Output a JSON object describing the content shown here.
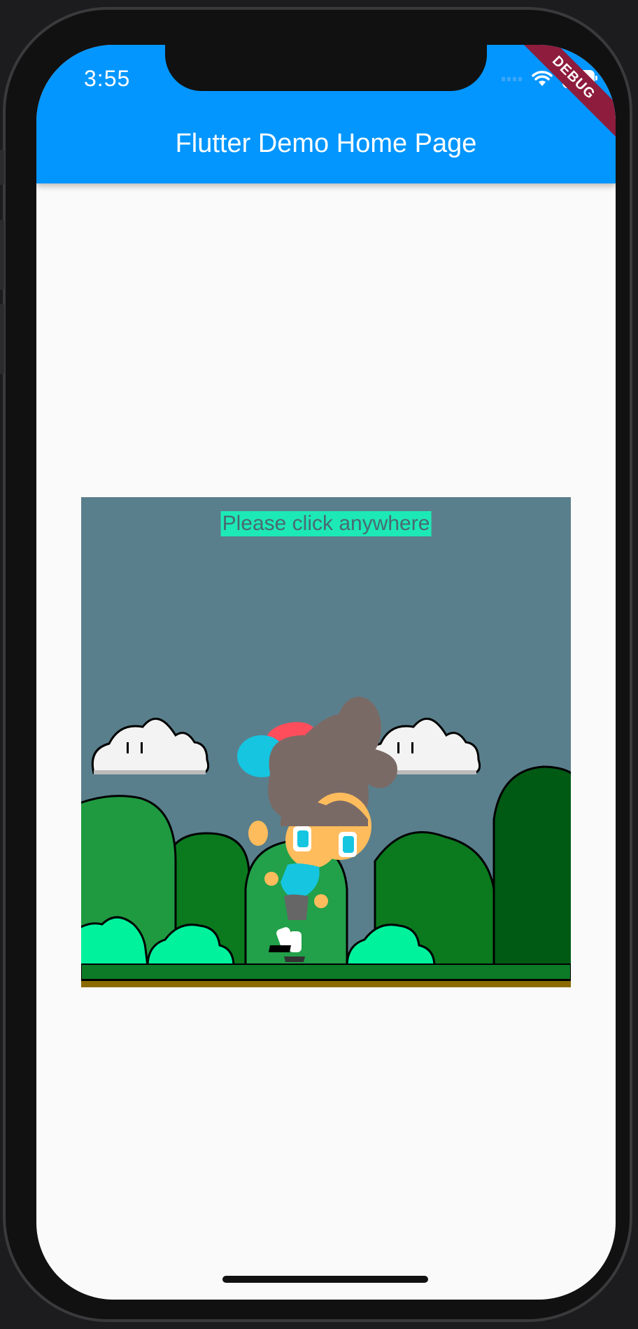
{
  "status_bar": {
    "time": "3:55"
  },
  "debug_banner": "DEBUG",
  "app_bar": {
    "title": "Flutter Demo Home Page"
  },
  "game": {
    "hint_text": "Please click anywhere"
  },
  "colors": {
    "app_bar": "#0396ff",
    "sky": "#5a7f8c",
    "hint_background": "#1de9b6",
    "debug_banner": "#8e1c3c"
  }
}
